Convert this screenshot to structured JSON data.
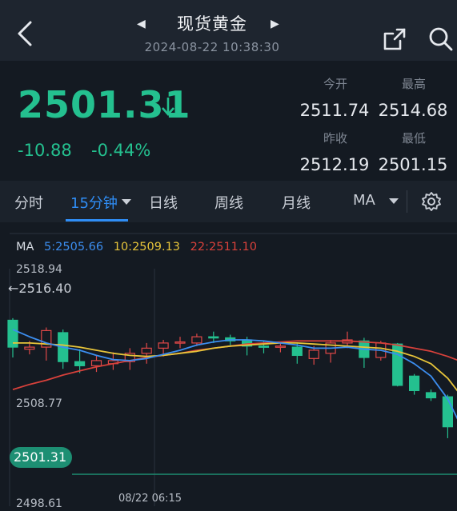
{
  "header": {
    "title": "现货黄金",
    "datetime": "2024-08-22 10:38:30"
  },
  "quote": {
    "price": "2501.31",
    "change": "-10.88",
    "change_pct": "-0.44%",
    "direction": "down",
    "open_label": "今开",
    "open": "2511.74",
    "high_label": "最高",
    "high": "2514.68",
    "prev_close_label": "昨收",
    "prev_close": "2512.19",
    "low_label": "最低",
    "low": "2501.15"
  },
  "tabs": [
    {
      "label": "分时"
    },
    {
      "label": "15分钟",
      "active": true
    },
    {
      "label": "日线"
    },
    {
      "label": "周线"
    },
    {
      "label": "月线"
    },
    {
      "label": "MA"
    }
  ],
  "colors": {
    "up": "#e04848",
    "down": "#24c08f",
    "ma5": "#3c8ef0",
    "ma10": "#e8c53a",
    "ma22": "#d8413b",
    "accent": "#2f8df5"
  },
  "chart_data": {
    "type": "candlestick",
    "ma_legend": {
      "label": "MA",
      "ma5": "5:2505.66",
      "ma10": "10:2509.13",
      "ma22": "22:2511.10"
    },
    "y_ticks": [
      "2518.94",
      "2508.77",
      "2498.61"
    ],
    "ylim": [
      2498.61,
      2518.94
    ],
    "high_marker": "2516.40",
    "current_price": "2501.31",
    "x_tick": "08/22 06:15",
    "candles": [
      {
        "o": 2516.2,
        "c": 2513.6,
        "h": 2516.4,
        "l": 2512.6
      },
      {
        "o": 2513.4,
        "c": 2513.6,
        "h": 2514.2,
        "l": 2512.9
      },
      {
        "o": 2513.6,
        "c": 2515.2,
        "h": 2515.5,
        "l": 2512.3
      },
      {
        "o": 2515.0,
        "c": 2512.2,
        "h": 2515.3,
        "l": 2511.5
      },
      {
        "o": 2512.2,
        "c": 2511.8,
        "h": 2513.4,
        "l": 2511.1
      },
      {
        "o": 2511.8,
        "c": 2512.3,
        "h": 2512.8,
        "l": 2511.2
      },
      {
        "o": 2512.0,
        "c": 2512.3,
        "h": 2513.1,
        "l": 2511.4
      },
      {
        "o": 2512.2,
        "c": 2513.0,
        "h": 2513.5,
        "l": 2511.4
      },
      {
        "o": 2513.0,
        "c": 2513.5,
        "h": 2514.0,
        "l": 2512.0
      },
      {
        "o": 2513.5,
        "c": 2514.0,
        "h": 2514.3,
        "l": 2512.7
      },
      {
        "o": 2514.0,
        "c": 2514.1,
        "h": 2514.6,
        "l": 2513.5
      },
      {
        "o": 2514.0,
        "c": 2514.6,
        "h": 2514.9,
        "l": 2513.7
      },
      {
        "o": 2514.6,
        "c": 2514.5,
        "h": 2515.1,
        "l": 2514.0
      },
      {
        "o": 2514.5,
        "c": 2514.2,
        "h": 2514.8,
        "l": 2513.8
      },
      {
        "o": 2514.3,
        "c": 2513.7,
        "h": 2514.6,
        "l": 2512.8
      },
      {
        "o": 2513.7,
        "c": 2513.6,
        "h": 2514.2,
        "l": 2513.0
      },
      {
        "o": 2513.6,
        "c": 2513.7,
        "h": 2514.0,
        "l": 2513.1
      },
      {
        "o": 2513.6,
        "c": 2512.8,
        "h": 2514.0,
        "l": 2512.0
      },
      {
        "o": 2512.5,
        "c": 2513.3,
        "h": 2513.7,
        "l": 2511.9
      },
      {
        "o": 2513.0,
        "c": 2514.0,
        "h": 2514.3,
        "l": 2512.1
      },
      {
        "o": 2514.0,
        "c": 2514.3,
        "h": 2515.1,
        "l": 2513.5
      },
      {
        "o": 2514.2,
        "c": 2512.6,
        "h": 2514.5,
        "l": 2511.6
      },
      {
        "o": 2512.6,
        "c": 2514.0,
        "h": 2514.2,
        "l": 2512.3
      },
      {
        "o": 2513.9,
        "c": 2509.9,
        "h": 2514.0,
        "l": 2509.8
      },
      {
        "o": 2510.8,
        "c": 2509.4,
        "h": 2511.0,
        "l": 2509.0
      },
      {
        "o": 2509.2,
        "c": 2508.7,
        "h": 2509.5,
        "l": 2508.4
      },
      {
        "o": 2508.8,
        "c": 2505.9,
        "h": 2509.0,
        "l": 2504.8
      },
      {
        "o": 2503.8,
        "c": 2501.3,
        "h": 2504.0,
        "l": 2501.1
      }
    ],
    "ma5": [
      2515.3,
      2514.6,
      2514.0,
      2513.6,
      2513.3,
      2512.8,
      2512.4,
      2512.3,
      2512.5,
      2512.9,
      2513.3,
      2513.8,
      2514.1,
      2514.3,
      2514.3,
      2514.2,
      2514.0,
      2513.8,
      2513.5,
      2513.5,
      2513.6,
      2513.4,
      2513.3,
      2512.9,
      2512.0,
      2510.8,
      2508.6,
      2505.3
    ],
    "ma10": [
      2514.0,
      2514.0,
      2513.9,
      2513.8,
      2513.6,
      2513.3,
      2513.0,
      2512.8,
      2512.7,
      2512.8,
      2513.0,
      2513.2,
      2513.5,
      2513.7,
      2513.8,
      2513.9,
      2514.0,
      2514.0,
      2513.9,
      2513.8,
      2513.7,
      2513.6,
      2513.5,
      2513.2,
      2512.7,
      2512.0,
      2510.6,
      2508.5
    ],
    "ma22": [
      2509.5,
      2510.0,
      2510.4,
      2510.9,
      2511.3,
      2511.7,
      2512.0,
      2512.3,
      2512.6,
      2512.8,
      2513.0,
      2513.3,
      2513.5,
      2513.7,
      2513.9,
      2514.0,
      2514.1,
      2514.2,
      2514.2,
      2514.2,
      2514.2,
      2514.1,
      2514.0,
      2513.8,
      2513.5,
      2513.2,
      2512.7,
      2512.1
    ]
  }
}
